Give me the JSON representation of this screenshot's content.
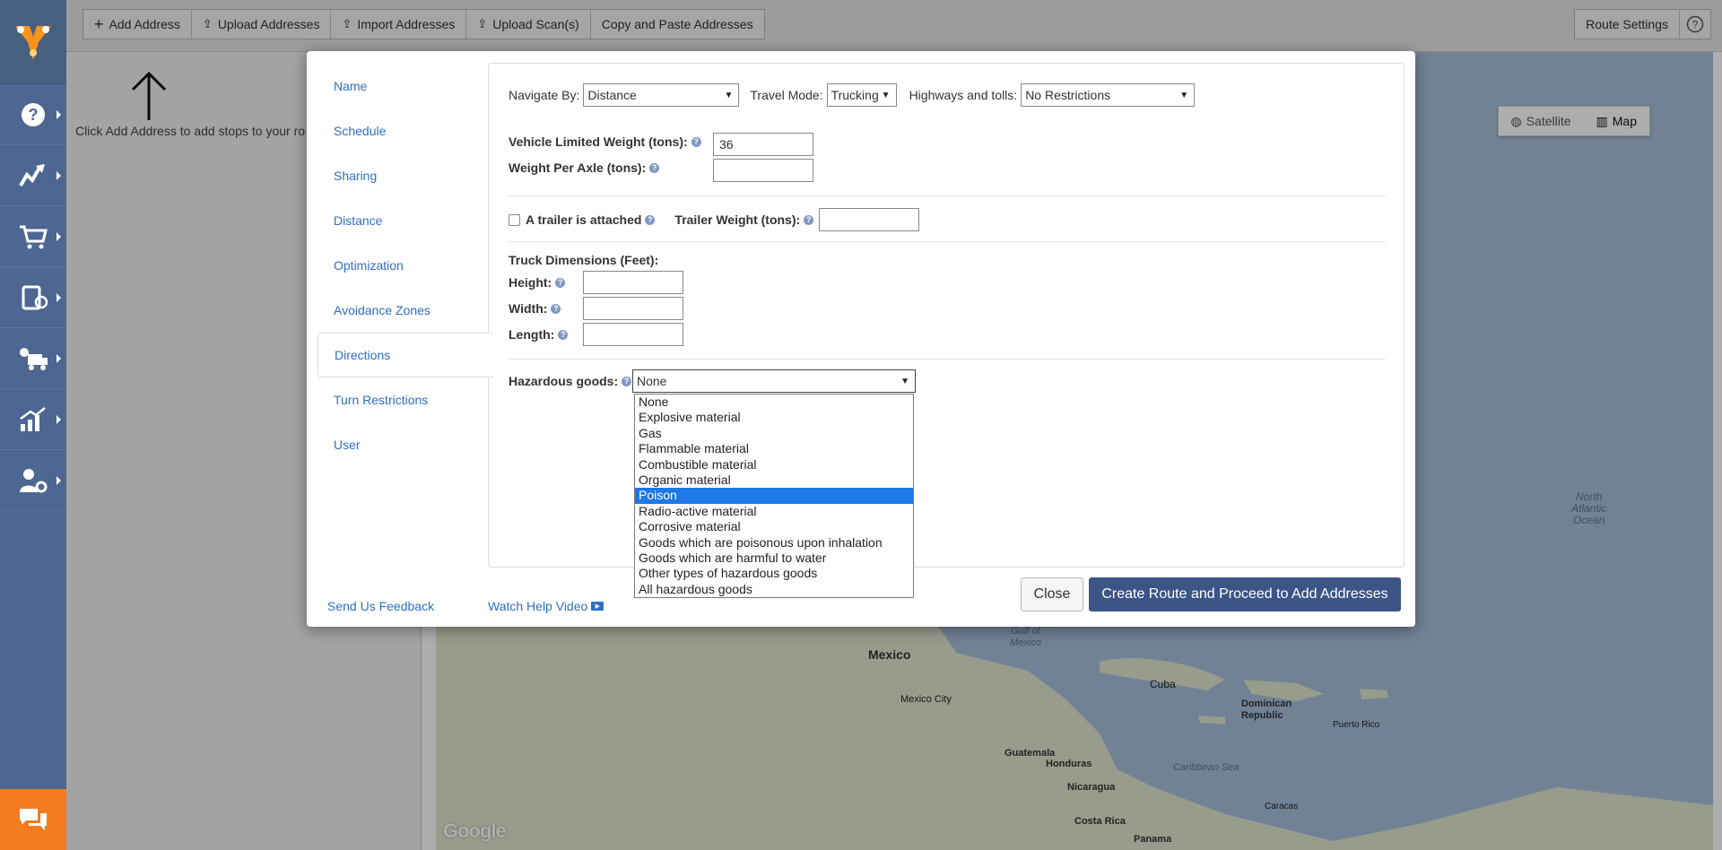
{
  "toolbar": {
    "add_address": "Add Address",
    "upload_addresses": "Upload Addresses",
    "import_addresses": "Import Addresses",
    "upload_scans": "Upload Scan(s)",
    "copy_paste": "Copy and Paste Addresses",
    "route_settings": "Route Settings"
  },
  "left_panel": {
    "hint": "Click Add Address to add stops to your ro"
  },
  "map": {
    "satellite_label": "Satellite",
    "map_label": "Map",
    "labels": {
      "north_atlantic": "North",
      "north_atlantic_2": "Atlantic",
      "north_atlantic_3": "Ocean",
      "gulf": "Gulf of",
      "gulf_2": "Mexico",
      "mexico": "Mexico",
      "mexico_city": "Mexico City",
      "cuba": "Cuba",
      "dominican": "Dominican",
      "republic": "Republic",
      "puerto_rico": "Puerto Rico",
      "guatemala": "Guatemala",
      "honduras": "Honduras",
      "caribbean": "Caribbean Sea",
      "nicaragua": "Nicaragua",
      "costa_rica": "Costa Rica",
      "caracas": "Caracas",
      "panama": "Panama"
    },
    "google": "Google"
  },
  "modal": {
    "nav": [
      "Name",
      "Schedule",
      "Sharing",
      "Distance",
      "Optimization",
      "Avoidance Zones",
      "Directions",
      "Turn Restrictions",
      "User"
    ],
    "active_nav_index": 6,
    "navigate_by_label": "Navigate By:",
    "navigate_by_value": "Distance",
    "travel_mode_label": "Travel Mode:",
    "travel_mode_value": "Trucking",
    "highways_label": "Highways and tolls:",
    "highways_value": "No Restrictions",
    "vehicle_weight_label": "Vehicle Limited Weight (tons):",
    "vehicle_weight_value": "36",
    "weight_per_axle_label": "Weight Per Axle (tons):",
    "weight_per_axle_value": "",
    "trailer_label": "A trailer is attached",
    "trailer_weight_label": "Trailer Weight (tons):",
    "truck_dimensions_label": "Truck Dimensions (Feet):",
    "height_label": "Height:",
    "width_label": "Width:",
    "length_label": "Length:",
    "hazardous_label": "Hazardous goods:",
    "hazardous_value": "None",
    "hazardous_options": [
      "None",
      "Explosive material",
      "Gas",
      "Flammable material",
      "Combustible material",
      "Organic material",
      "Poison",
      "Radio-active material",
      "Corrosive material",
      "Goods which are poisonous upon inhalation",
      "Goods which are harmful to water",
      "Other types of hazardous goods",
      "All hazardous goods"
    ],
    "hazardous_highlighted_index": 6,
    "send_feedback": "Send Us Feedback",
    "watch_video": "Watch Help Video",
    "close_button": "Close",
    "create_button": "Create Route and Proceed to Add Addresses"
  },
  "colors": {
    "sidebar": "#4d6692",
    "accent": "#3c5587",
    "link": "#2f6fbf",
    "chat": "#f47b20",
    "highlight": "#1e78e6"
  }
}
